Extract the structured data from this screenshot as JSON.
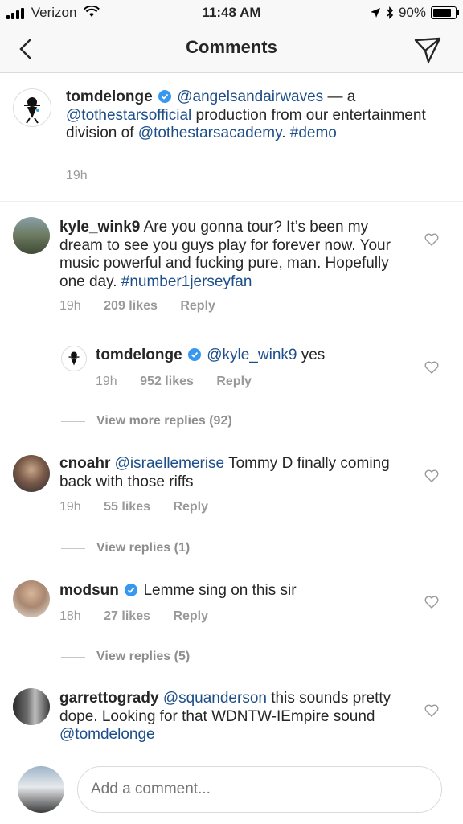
{
  "status": {
    "carrier": "Verizon",
    "time": "11:48 AM",
    "battery": "90%",
    "battery_level": 0.9
  },
  "nav": {
    "title": "Comments"
  },
  "caption": {
    "username": "tomdelonge",
    "mention1": "@angelsandairwaves",
    "text1": " — a ",
    "mention2": "@tothestarsofficial",
    "text2": " production from our entertainment division of ",
    "mention3": "@tothestarsacademy",
    "text3": ".  ",
    "hashtag": "#demo",
    "time": "19h"
  },
  "comments": [
    {
      "username": "kyle_wink9",
      "text": "Are you gonna tour? It’s been my dream to see you guys play for forever now. Your music powerful and fucking pure, man. Hopefully one day. ",
      "hashtag": "#number1jerseyfan",
      "time": "19h",
      "likes": "209 likes",
      "reply": "Reply"
    },
    {
      "username": "tomdelonge",
      "mention": "@kyle_wink9",
      "text": " yes",
      "time": "19h",
      "likes": "952 likes",
      "reply": "Reply"
    },
    {
      "username": "cnoahr",
      "mention": "@israellemerise",
      "text": " Tommy D finally coming back with those riffs",
      "time": "19h",
      "likes": "55 likes",
      "reply": "Reply"
    },
    {
      "username": "modsun",
      "text": "Lemme sing on this sir",
      "time": "18h",
      "likes": "27 likes",
      "reply": "Reply"
    },
    {
      "username": "garrettogrady",
      "mention": "@squanderson",
      "text": " this sounds pretty dope. Looking for that WDNTW-IEmpire sound ",
      "mention2": "@tomdelonge"
    }
  ],
  "view_replies": {
    "first": "View more replies (92)",
    "second": "View replies (1)",
    "third": "View replies (5)"
  },
  "composer": {
    "placeholder": "Add a comment..."
  },
  "colors": {
    "link": "#1d4e89",
    "verified": "#3897f0",
    "muted": "#999999"
  }
}
